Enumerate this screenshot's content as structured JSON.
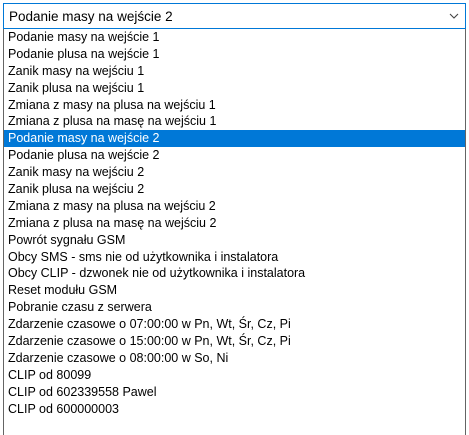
{
  "combo": {
    "selected_value": "Podanie masy na wejście 2",
    "arrow_icon": "chevron-down-icon"
  },
  "colors": {
    "selection_background": "#0078d7",
    "selection_text": "#ffffff"
  },
  "list": {
    "selected_index": 6,
    "items": [
      "Podanie masy na wejście 1",
      "Podanie plusa na wejście 1",
      "Zanik masy na wejściu 1",
      "Zanik plusa na wejściu 1",
      "Zmiana z masy na plusa na wejściu 1",
      "Zmiana z plusa na masę na wejściu 1",
      "Podanie masy na wejście 2",
      "Podanie plusa na wejście 2",
      "Zanik masy na wejściu 2",
      "Zanik plusa na wejściu 2",
      "Zmiana z masy na plusa na wejściu 2",
      "Zmiana z plusa na masę na wejściu 2",
      "Powrót sygnału GSM",
      "Obcy SMS - sms nie od użytkownika i instalatora",
      "Obcy CLIP - dzwonek nie od użytkownika i instalatora",
      "Reset modułu GSM",
      "Pobranie czasu z serwera",
      "Zdarzenie czasowe o 07:00:00 w Pn, Wt, Śr, Cz, Pi",
      "Zdarzenie czasowe o 15:00:00 w Pn, Wt, Śr, Cz, Pi",
      "Zdarzenie czasowe o 08:00:00 w So, Ni",
      "CLIP od 80099",
      "CLIP od 602339558 Pawel",
      "CLIP od 600000003"
    ]
  }
}
